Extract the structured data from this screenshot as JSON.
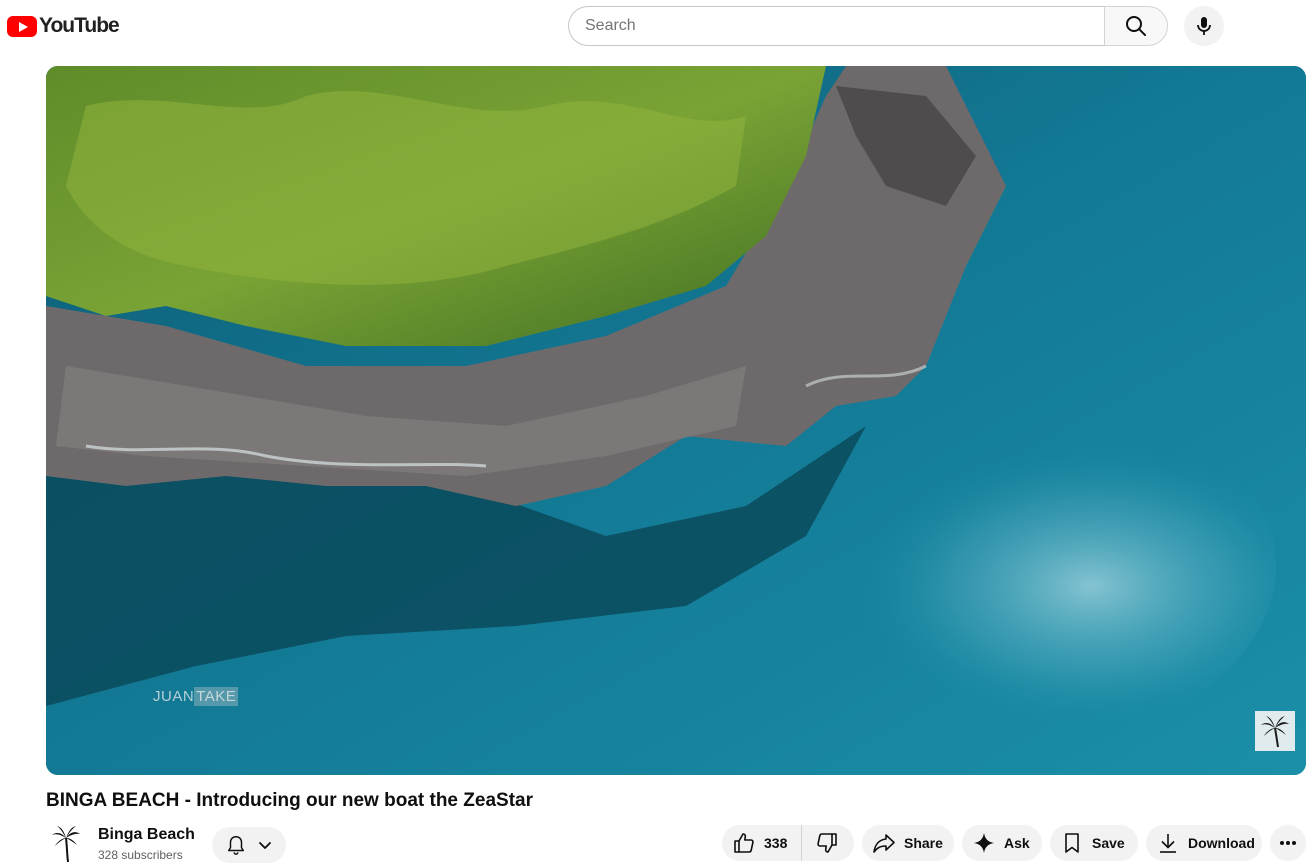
{
  "masthead": {
    "logo_text": "YouTube",
    "search": {
      "placeholder": "Search",
      "value": ""
    },
    "icons": {
      "search": "search-icon",
      "mic": "mic-icon"
    }
  },
  "player": {
    "watermark_part1": "JUAN",
    "watermark_part2": "TAKE",
    "branding_icon": "palm-tree-icon"
  },
  "video": {
    "title": "BINGA BEACH - Introducing our new boat the ZeaStar"
  },
  "channel": {
    "name": "Binga Beach",
    "subscribers": "328 subscribers",
    "avatar_icon": "palm-tree-icon"
  },
  "actions": {
    "like_count": "338",
    "share_label": "Share",
    "ask_label": "Ask",
    "save_label": "Save",
    "download_label": "Download"
  },
  "colors": {
    "brand_red": "#ff0000",
    "button_bg": "#f2f2f2",
    "text_primary": "#0f0f0f",
    "text_secondary": "#606060"
  }
}
